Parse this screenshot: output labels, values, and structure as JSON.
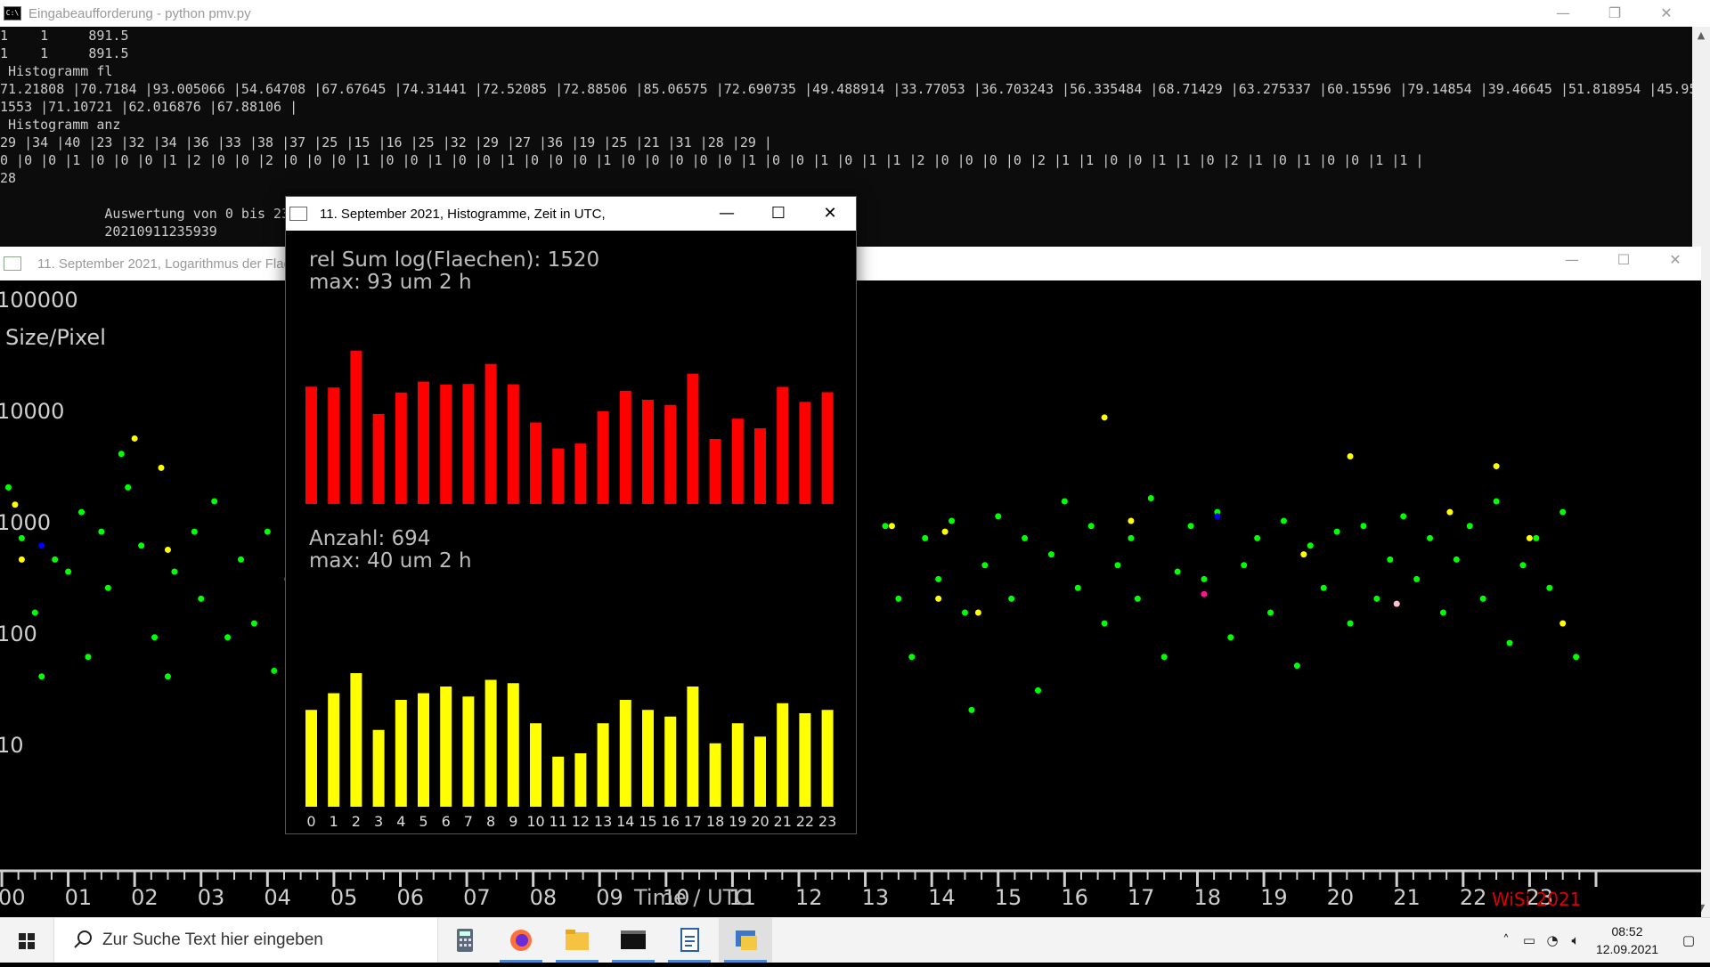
{
  "console": {
    "title": "Eingabeaufforderung - python  pmv.py",
    "lines": [
      "1    1     891.5",
      "1    1     891.5",
      " Histogramm fl",
      "71.21808 |70.7184 |93.005066 |54.64708 |67.67645 |74.31441 |72.52085 |72.88506 |85.06575 |72.690735 |49.488914 |33.77053 |36.703243 |56.335484 |68.71429 |63.275337 |60.15596 |79.14854 |39.46645 |51.818954 |45.95",
      "1553 |71.10721 |62.016876 |67.88106 |",
      " Histogramm anz",
      "29 |34 |40 |23 |32 |34 |36 |33 |38 |37 |25 |15 |16 |25 |32 |29 |27 |36 |19 |25 |21 |31 |28 |29 |",
      "0 |0 |0 |1 |0 |0 |0 |1 |2 |0 |0 |2 |0 |0 |0 |1 |0 |0 |1 |0 |0 |1 |0 |0 |0 |1 |0 |0 |0 |0 |0 |1 |0 |0 |1 |0 |1 |1 |2 |0 |0 |0 |0 |2 |1 |1 |0 |0 |1 |1 |0 |2 |1 |0 |1 |0 |0 |1 |1 |",
      "28",
      "",
      "             Auswertung von 0 bis 23",
      "             20210911235939"
    ],
    "controls": {
      "min": "—",
      "max": "❐",
      "close": "✕"
    }
  },
  "scatter": {
    "title": "11. September 2021, Logarithmus der Flaechen",
    "y_title": "Size/Pixel",
    "y_ticks": [
      "100000",
      "10000",
      "1000",
      "100",
      "10"
    ],
    "x_ticks": [
      "00",
      "01",
      "02",
      "03",
      "04",
      "05",
      "06",
      "07",
      "08",
      "09",
      "10",
      "11",
      "12",
      "13",
      "14",
      "15",
      "16",
      "17",
      "18",
      "19",
      "20",
      "21",
      "22",
      "23"
    ],
    "x_title": "Time / UTC",
    "signature": "WiSi 2021",
    "controls": {
      "min": "—",
      "max": "☐",
      "close": "✕"
    }
  },
  "histogram": {
    "title": "11. September 2021, Histogramme, Zeit in UTC,",
    "area_line1": "rel Sum log(Flaechen): 1520",
    "area_line2": "max: 93 um 2 h",
    "count_line1": "Anzahl: 694",
    "count_line2": "max: 40 um 2 h",
    "controls": {
      "min": "—",
      "max": "☐",
      "close": "✕"
    },
    "area_color": "#ff0000",
    "count_color": "#ffff00"
  },
  "chart_data": [
    {
      "type": "bar",
      "categories": [
        "0",
        "1",
        "2",
        "3",
        "4",
        "5",
        "6",
        "7",
        "8",
        "9",
        "10",
        "11",
        "12",
        "13",
        "14",
        "15",
        "16",
        "17",
        "18",
        "19",
        "20",
        "21",
        "22",
        "23"
      ],
      "values": [
        71.21808,
        70.7184,
        93.005066,
        54.64708,
        67.67645,
        74.31441,
        72.52085,
        72.88506,
        85.06575,
        72.690735,
        49.488914,
        33.77053,
        36.703243,
        56.335484,
        68.71429,
        63.275337,
        60.15596,
        79.14854,
        39.46645,
        51.818954,
        45.951553,
        71.10721,
        62.016876,
        67.88106
      ],
      "ylim": [
        0,
        100
      ]
    },
    {
      "type": "bar",
      "categories": [
        "0",
        "1",
        "2",
        "3",
        "4",
        "5",
        "6",
        "7",
        "8",
        "9",
        "10",
        "11",
        "12",
        "13",
        "14",
        "15",
        "16",
        "17",
        "18",
        "19",
        "20",
        "21",
        "22",
        "23"
      ],
      "values": [
        29,
        34,
        40,
        23,
        32,
        34,
        36,
        33,
        38,
        37,
        25,
        15,
        16,
        25,
        32,
        29,
        27,
        36,
        19,
        25,
        21,
        31,
        28,
        29
      ],
      "ylim": [
        0,
        45
      ]
    },
    {
      "type": "scatter",
      "xlim": [
        0,
        24
      ],
      "ylim": [
        1,
        100000
      ],
      "log_y": true,
      "series": [
        {
          "color": "#00ff00",
          "points": [
            [
              0.1,
              2000
            ],
            [
              0.3,
              700
            ],
            [
              0.5,
              150
            ],
            [
              0.6,
              40
            ],
            [
              0.8,
              450
            ],
            [
              1.0,
              350
            ],
            [
              1.2,
              1200
            ],
            [
              1.3,
              60
            ],
            [
              1.5,
              800
            ],
            [
              1.6,
              250
            ],
            [
              1.8,
              4000
            ],
            [
              1.9,
              2000
            ],
            [
              2.1,
              600
            ],
            [
              2.3,
              90
            ],
            [
              2.5,
              40
            ],
            [
              2.6,
              350
            ],
            [
              2.9,
              800
            ],
            [
              3.0,
              200
            ],
            [
              3.2,
              1500
            ],
            [
              3.4,
              90
            ],
            [
              3.6,
              450
            ],
            [
              3.8,
              120
            ],
            [
              4.0,
              800
            ],
            [
              4.1,
              45
            ],
            [
              4.3,
              300
            ],
            [
              4.4,
              700
            ],
            [
              4.6,
              20
            ],
            [
              4.8,
              1500
            ],
            [
              4.9,
              250
            ],
            [
              5.1,
              150
            ],
            [
              13.3,
              900
            ],
            [
              13.5,
              200
            ],
            [
              13.7,
              60
            ],
            [
              13.9,
              700
            ],
            [
              14.1,
              300
            ],
            [
              14.3,
              1000
            ],
            [
              14.5,
              150
            ],
            [
              14.6,
              20
            ],
            [
              14.8,
              400
            ],
            [
              15.0,
              1100
            ],
            [
              15.2,
              200
            ],
            [
              15.4,
              700
            ],
            [
              15.6,
              30
            ],
            [
              15.8,
              500
            ],
            [
              16.0,
              1500
            ],
            [
              16.2,
              250
            ],
            [
              16.4,
              900
            ],
            [
              16.6,
              120
            ],
            [
              16.8,
              400
            ],
            [
              17.0,
              700
            ],
            [
              17.1,
              200
            ],
            [
              17.3,
              1600
            ],
            [
              17.5,
              60
            ],
            [
              17.7,
              350
            ],
            [
              17.9,
              900
            ],
            [
              18.1,
              300
            ],
            [
              18.3,
              1200
            ],
            [
              18.5,
              90
            ],
            [
              18.7,
              400
            ],
            [
              18.9,
              700
            ],
            [
              19.1,
              150
            ],
            [
              19.3,
              1000
            ],
            [
              19.5,
              50
            ],
            [
              19.7,
              600
            ],
            [
              19.9,
              250
            ],
            [
              20.1,
              800
            ],
            [
              20.3,
              120
            ],
            [
              20.5,
              900
            ],
            [
              20.7,
              200
            ],
            [
              20.9,
              450
            ],
            [
              21.1,
              1100
            ],
            [
              21.3,
              300
            ],
            [
              21.5,
              700
            ],
            [
              21.7,
              150
            ],
            [
              21.9,
              450
            ],
            [
              22.1,
              900
            ],
            [
              22.3,
              200
            ],
            [
              22.5,
              1500
            ],
            [
              22.7,
              80
            ],
            [
              22.9,
              400
            ],
            [
              23.1,
              700
            ],
            [
              23.3,
              250
            ],
            [
              23.5,
              1200
            ],
            [
              23.7,
              60
            ]
          ]
        },
        {
          "color": "#ffff00",
          "points": [
            [
              0.2,
              1400
            ],
            [
              0.3,
              450
            ],
            [
              2.0,
              5500
            ],
            [
              2.4,
              3000
            ],
            [
              2.5,
              550
            ],
            [
              13.4,
              900
            ],
            [
              14.1,
              200
            ],
            [
              14.2,
              800
            ],
            [
              14.7,
              150
            ],
            [
              16.6,
              8500
            ],
            [
              17.0,
              1000
            ],
            [
              19.6,
              500
            ],
            [
              20.3,
              3800
            ],
            [
              21.8,
              1200
            ],
            [
              22.5,
              3100
            ],
            [
              23.0,
              700
            ],
            [
              23.5,
              120
            ]
          ]
        },
        {
          "color": "#0000ff",
          "points": [
            [
              0.6,
              600
            ],
            [
              18.3,
              1100
            ]
          ]
        },
        {
          "color": "#ff1493",
          "points": [
            [
              18.1,
              220
            ]
          ]
        },
        {
          "color": "#ffc0cb",
          "points": [
            [
              21.0,
              180
            ]
          ]
        }
      ]
    }
  ],
  "taskbar": {
    "search_placeholder": "Zur Suche Text hier eingeben",
    "time": "08:52",
    "date": "12.09.2021"
  }
}
